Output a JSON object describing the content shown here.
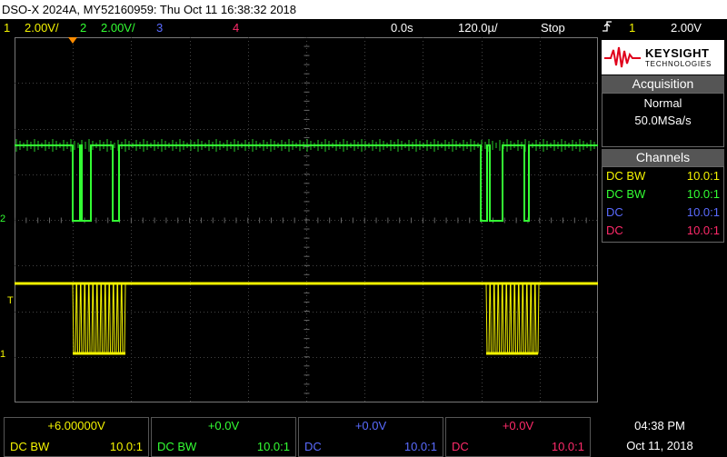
{
  "window": {
    "title": "DSO-X 2024A, MY52160959: Thu Oct 11 16:38:32 2018"
  },
  "status": {
    "ch1_index": "1",
    "ch1_scale": "2.00V/",
    "ch2_index": "2",
    "ch2_scale": "2.00V/",
    "ch3_index": "3",
    "ch4_index": "4",
    "time_delay": "0.0s",
    "time_scale": "120.0µ/",
    "run_state": "Stop",
    "trigger_icon": "trigger-edge-icon",
    "trigger_channel": "1",
    "trigger_level": "2.00V"
  },
  "brand": {
    "name": "KEYSIGHT",
    "sub": "TECHNOLOGIES"
  },
  "acquisition": {
    "title": "Acquisition",
    "mode": "Normal",
    "rate": "50.0MSa/s"
  },
  "channels_panel": {
    "title": "Channels",
    "rows": [
      {
        "coupling": "DC BW",
        "ratio": "10.0:1",
        "color": "#f4f400"
      },
      {
        "coupling": "DC BW",
        "ratio": "10.0:1",
        "color": "#33ff33"
      },
      {
        "coupling": "DC",
        "ratio": "10.0:1",
        "color": "#5a6bff"
      },
      {
        "coupling": "DC",
        "ratio": "10.0:1",
        "color": "#ff2a6a"
      }
    ]
  },
  "markers": {
    "ch2": "2",
    "trigger": "T",
    "ch1": "1"
  },
  "bottom_channels": [
    {
      "offset": "+6.00000V",
      "coupling": "DC   BW",
      "ratio": "10.0:1",
      "color": "#f4f400"
    },
    {
      "offset": "+0.0V",
      "coupling": "DC   BW",
      "ratio": "10.0:1",
      "color": "#33ff33"
    },
    {
      "offset": "+0.0V",
      "coupling": "DC",
      "ratio": "10.0:1",
      "color": "#5a6bff"
    },
    {
      "offset": "+0.0V",
      "coupling": "DC",
      "ratio": "10.0:1",
      "color": "#ff2a6a"
    }
  ],
  "clock": {
    "time": "04:38 PM",
    "date": "Oct 11, 2018"
  },
  "colors": {
    "ch1": "#f4f400",
    "ch2": "#33ff33",
    "ch3": "#5a6bff",
    "ch4": "#ff2a6a",
    "trigger_marker": "#ff8c00"
  },
  "traces": {
    "ch2_idle_level": "high",
    "ch1_idle_level": "high",
    "burst_count": 2
  }
}
